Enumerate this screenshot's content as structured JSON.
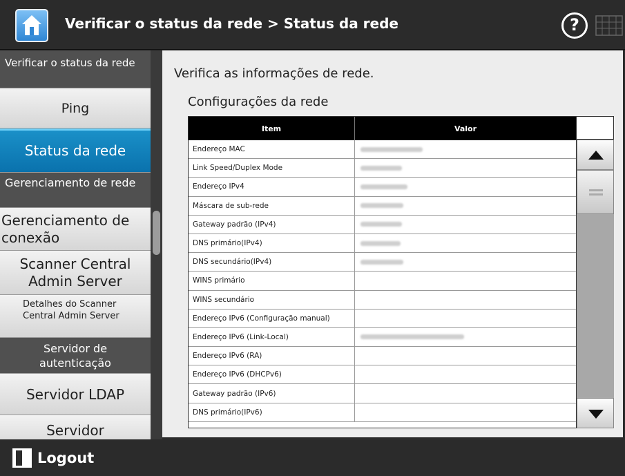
{
  "header": {
    "title": "Verificar o status da rede > Status da rede",
    "icons": {
      "home": "home-icon",
      "help": "help-icon",
      "keyboard": "keyboard-icon"
    }
  },
  "sidebar": {
    "items": [
      {
        "label": "Verificar o status da rede",
        "type": "category"
      },
      {
        "label": "Ping",
        "type": "item"
      },
      {
        "label": "Status da rede",
        "type": "item",
        "active": true
      },
      {
        "label": "Gerenciamento de rede",
        "type": "category"
      },
      {
        "label": "Gerenciamento de conexão",
        "type": "item"
      },
      {
        "label": "Scanner Central Admin Server",
        "type": "item"
      },
      {
        "label": "Detalhes do Scanner Central Admin Server",
        "type": "item"
      },
      {
        "label": "Servidor de autenticação",
        "type": "category"
      },
      {
        "label": "Servidor LDAP",
        "type": "item"
      },
      {
        "label": "Servidor",
        "type": "item"
      }
    ]
  },
  "main": {
    "description": "Verifica as informações de rede.",
    "section_title": "Configurações da rede",
    "table": {
      "columns": [
        "Item",
        "Valor"
      ],
      "rows": [
        {
          "item": "Endereço MAC",
          "value_redacted": true
        },
        {
          "item": "Link Speed/Duplex Mode",
          "value_redacted": true
        },
        {
          "item": "Endereço IPv4",
          "value_redacted": true
        },
        {
          "item": "Máscara de sub-rede",
          "value_redacted": true
        },
        {
          "item": "Gateway padrão (IPv4)",
          "value_redacted": true
        },
        {
          "item": "DNS primário(IPv4)",
          "value_redacted": true
        },
        {
          "item": "DNS secundário(IPv4)",
          "value_redacted": true
        },
        {
          "item": "WINS primário",
          "value_redacted": false
        },
        {
          "item": "WINS secundário",
          "value_redacted": false
        },
        {
          "item": "Endereço IPv6 (Configuração manual)",
          "value_redacted": false
        },
        {
          "item": "Endereço IPv6 (Link-Local)",
          "value_redacted": true
        },
        {
          "item": "Endereço IPv6 (RA)",
          "value_redacted": false
        },
        {
          "item": "Endereço IPv6 (DHCPv6)",
          "value_redacted": false
        },
        {
          "item": "Gateway padrão (IPv6)",
          "value_redacted": false
        },
        {
          "item": "DNS primário(IPv6)",
          "value_redacted": false
        }
      ]
    }
  },
  "footer": {
    "logout_label": "Logout"
  },
  "colors": {
    "accent": "#0a80bc",
    "header_bg": "#2b2b2b"
  }
}
